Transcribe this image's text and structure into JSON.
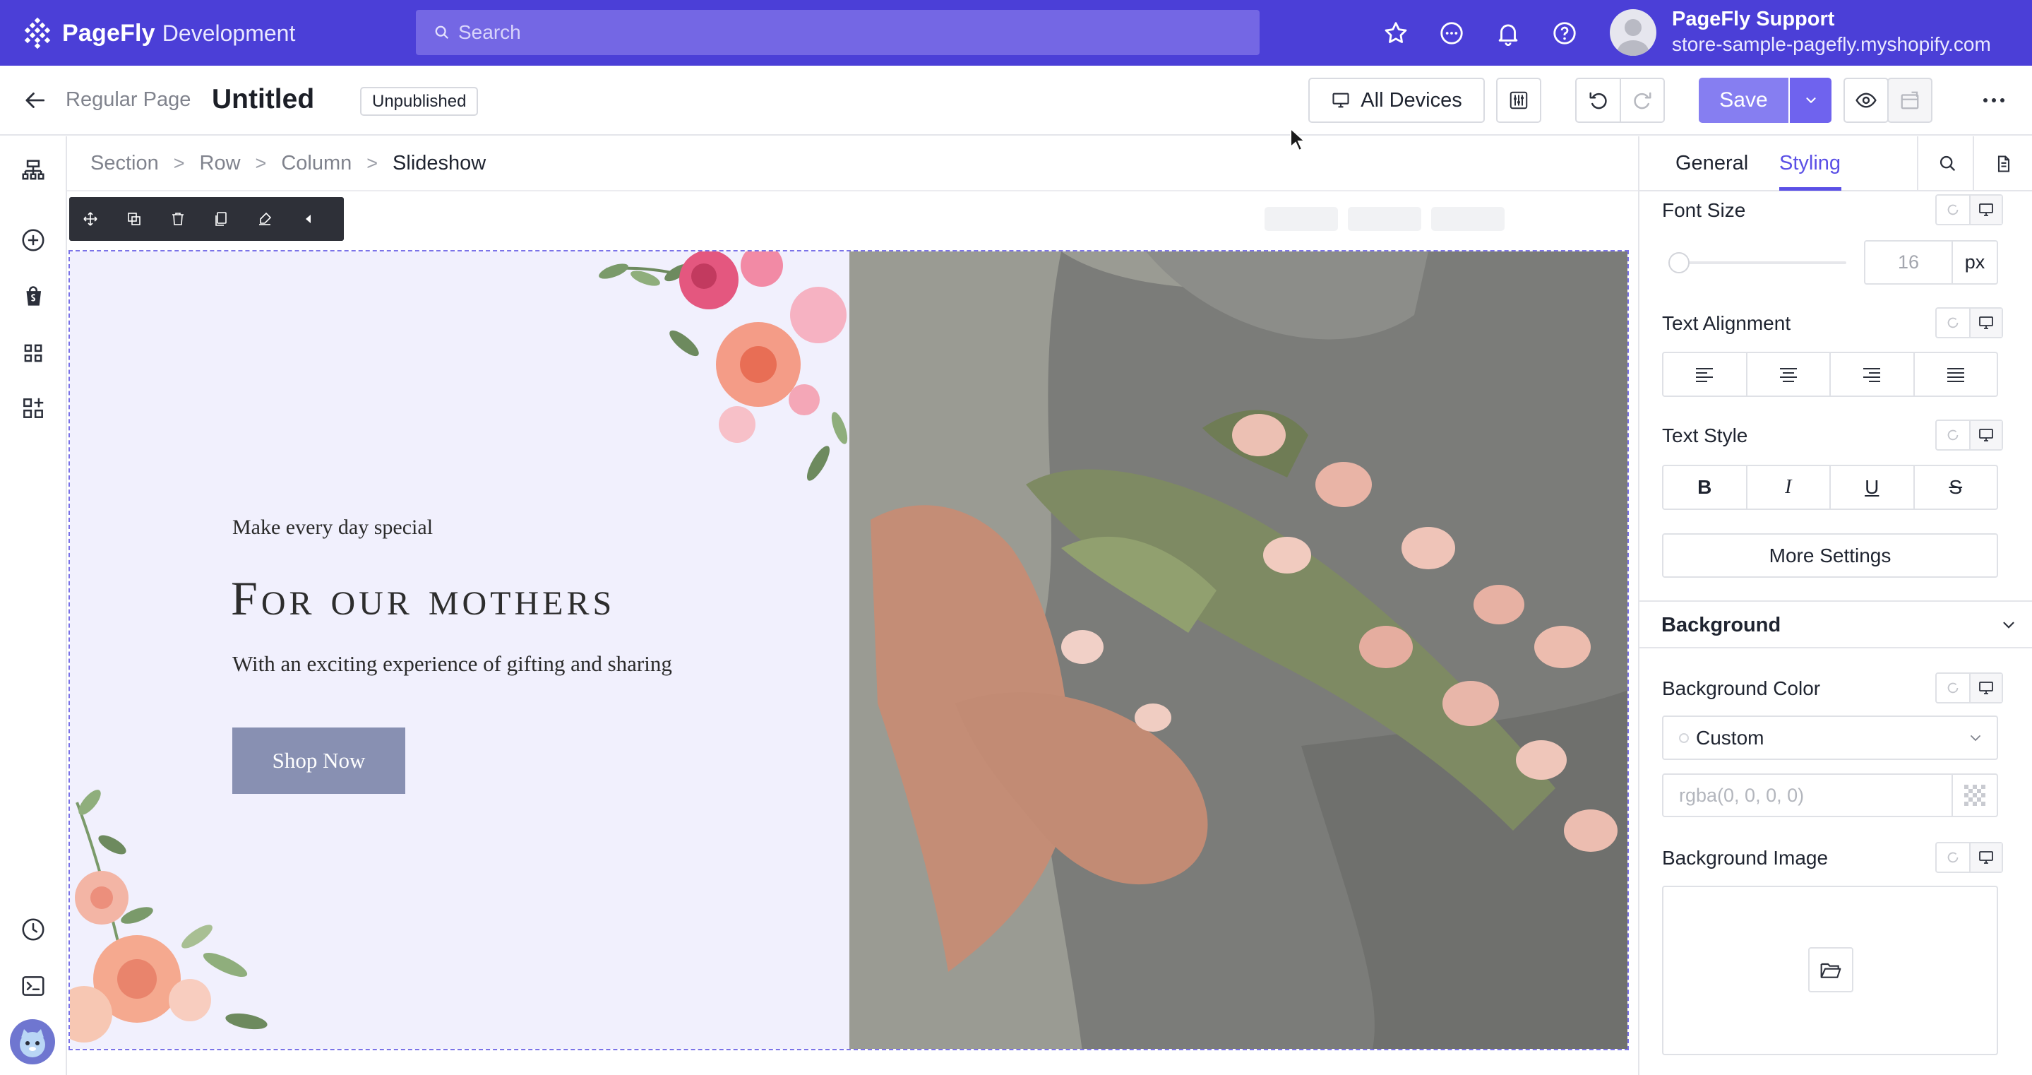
{
  "topbar": {
    "brand": "PageFly",
    "brand_sub": "Development",
    "search_placeholder": "Search",
    "user_name": "PageFly Support",
    "user_store": "store-sample-pagefly.myshopify.com",
    "icons": [
      "star-icon",
      "chat-icon",
      "bell-icon",
      "help-icon"
    ],
    "bg_color": "#4b3fd7"
  },
  "toolbar": {
    "page_type": "Regular Page",
    "title": "Untitled",
    "status": "Unpublished",
    "devices_label": "All Devices",
    "save_label": "Save"
  },
  "breadcrumb": {
    "items": [
      "Section",
      "Row",
      "Column"
    ],
    "current": "Slideshow",
    "separator": ">"
  },
  "slide": {
    "tagline": "Make every day special",
    "headline": "For our mothers",
    "subline": "With an exciting experience of gifting and sharing",
    "cta": "Shop Now",
    "accent": "#8890b2",
    "left_bg": "#f1f0fd"
  },
  "rpanel": {
    "tabs": [
      "General",
      "Styling"
    ],
    "active_tab": "Styling",
    "font_size_label": "Font Size",
    "font_size_value": "16",
    "font_size_unit": "px",
    "text_alignment_label": "Text Alignment",
    "text_style_label": "Text Style",
    "text_style_buttons": [
      "B",
      "I",
      "U",
      "S"
    ],
    "more_settings": "More Settings",
    "background_section": "Background",
    "bg_color_label": "Background Color",
    "bg_color_select": "Custom",
    "bg_color_placeholder": "rgba(0, 0, 0, 0)",
    "bg_image_label": "Background Image"
  },
  "accent_color": "#5b50e6"
}
